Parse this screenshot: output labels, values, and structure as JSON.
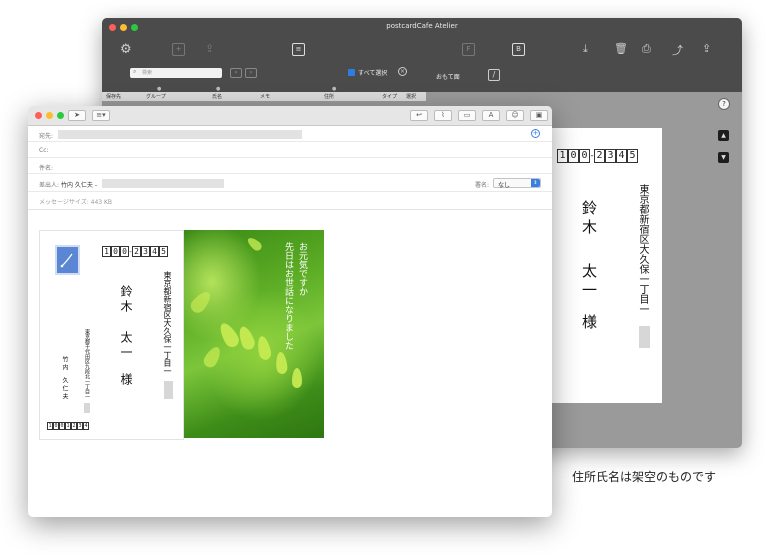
{
  "back_window": {
    "title": "postcardCafe Atelier",
    "toolbar_letters": {
      "f": "F",
      "b": "B"
    },
    "search_placeholder": "検索",
    "select_all_label": "すべて選択",
    "omote_label": "おもて面",
    "columns": [
      "保存先",
      "グループ",
      "氏名",
      "メモ",
      "住所",
      "タイプ",
      "選択"
    ],
    "card": {
      "zip": [
        "1",
        "0",
        "0",
        "2",
        "3",
        "4",
        "5"
      ],
      "address": "東京都新宿区大久保一丁目一",
      "name_family": "鈴木",
      "name_given": "太一",
      "honorific": "様"
    }
  },
  "mail_window": {
    "fields": {
      "to_label": "宛先:",
      "cc_label": "Cc:",
      "subject_label": "件名:",
      "from_label": "差出人:",
      "from_value": "竹内 久仁夫 -",
      "signature_label": "署名:",
      "signature_value": "なし",
      "size_text": "メッセージサイズ: 443 KB"
    },
    "toolbar_letter": "A",
    "postcard": {
      "zip": [
        "1",
        "0",
        "0",
        "2",
        "3",
        "4",
        "5"
      ],
      "address": "東京都新宿区大久保一丁目一",
      "name_family": "鈴木",
      "name_given": "太一",
      "honorific": "様",
      "sender_address": "東京都千代田区九段北一丁目一",
      "sender_name_family": "竹内",
      "sender_name_given": "久仁夫",
      "sender_zip": [
        "1",
        "0",
        "0",
        "1",
        "2",
        "3",
        "4"
      ]
    },
    "message_line1": "お元気ですか",
    "message_line2": "先日はお世話になりました"
  },
  "caption": "住所氏名は架空のものです",
  "colors": {
    "back_toolbar": "#4b4b4b",
    "back_body": "#9a9a9a",
    "checkbox_blue": "#2f7de1",
    "stamp_blue": "#5a86d4",
    "photo_green": "#5eae26"
  }
}
